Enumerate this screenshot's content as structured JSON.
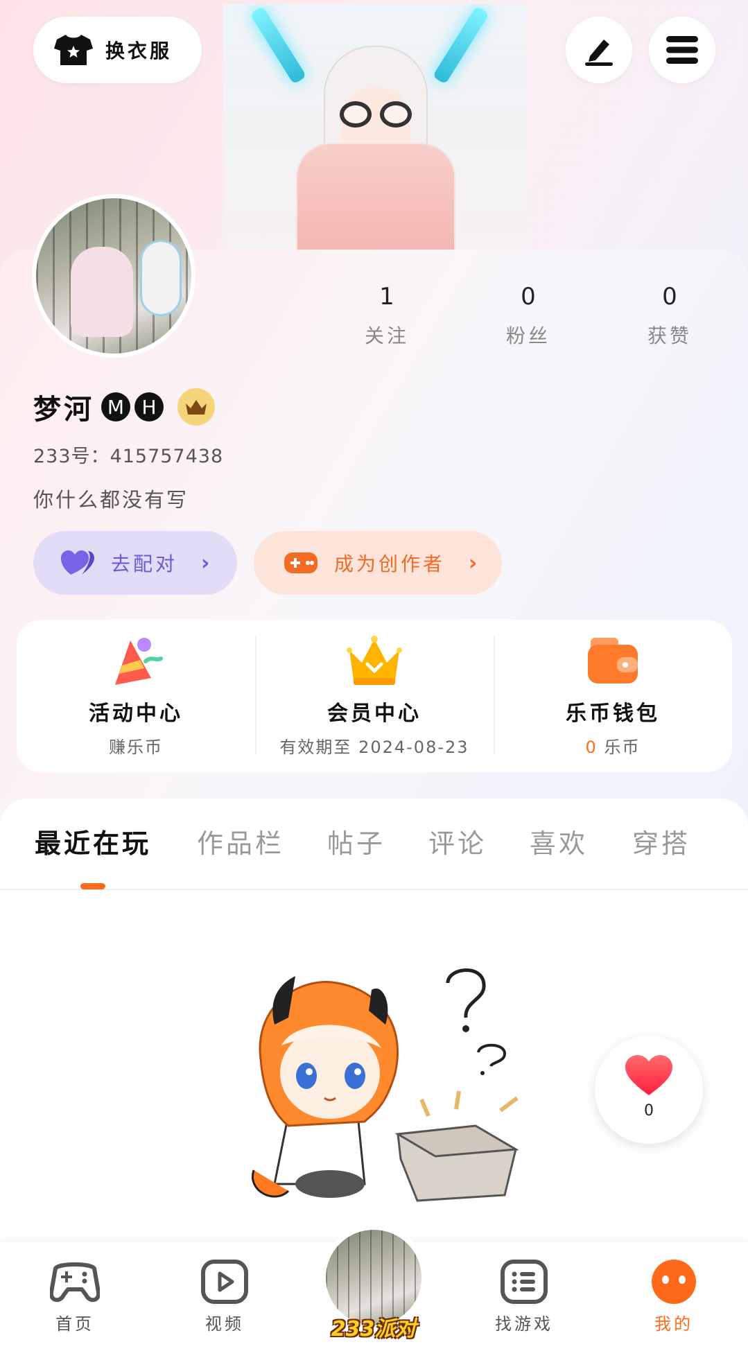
{
  "header": {
    "outfit_label": "换衣服",
    "edit_icon": "pencil-icon",
    "menu_icon": "menu-icon"
  },
  "profile": {
    "name": "梦河",
    "badges": [
      "M",
      "H"
    ],
    "uid": "233号：415757438",
    "bio": "你什么都没有写",
    "stats": [
      {
        "value": "1",
        "label": "关注"
      },
      {
        "value": "0",
        "label": "粉丝"
      },
      {
        "value": "0",
        "label": "获赞"
      }
    ],
    "match_label": "去配对",
    "creator_label": "成为创作者"
  },
  "services": [
    {
      "title": "活动中心",
      "sub": "赚乐币",
      "icon": "party-hat-icon"
    },
    {
      "title": "会员中心",
      "sub": "有效期至 2024-08-23",
      "icon": "crown-icon"
    },
    {
      "title": "乐币钱包",
      "sub_value": "0",
      "sub_unit": "乐币",
      "icon": "wallet-icon"
    }
  ],
  "tabs": [
    "最近在玩",
    "作品栏",
    "帖子",
    "评论",
    "喜欢",
    "穿搭"
  ],
  "active_tab": "最近在玩",
  "like_count": "0",
  "nav": {
    "items": [
      {
        "label": "首页",
        "icon": "gamepad-icon"
      },
      {
        "label": "视频",
        "icon": "play-icon"
      },
      {
        "label": "找游戏",
        "icon": "list-icon"
      },
      {
        "label": "我的",
        "icon": "face-icon"
      }
    ],
    "center_brand": "233派对",
    "active": "我的"
  },
  "colors": {
    "accent": "#ff6a1a",
    "match_purple": "#6e58d8",
    "creator_orange": "#f26a25"
  }
}
